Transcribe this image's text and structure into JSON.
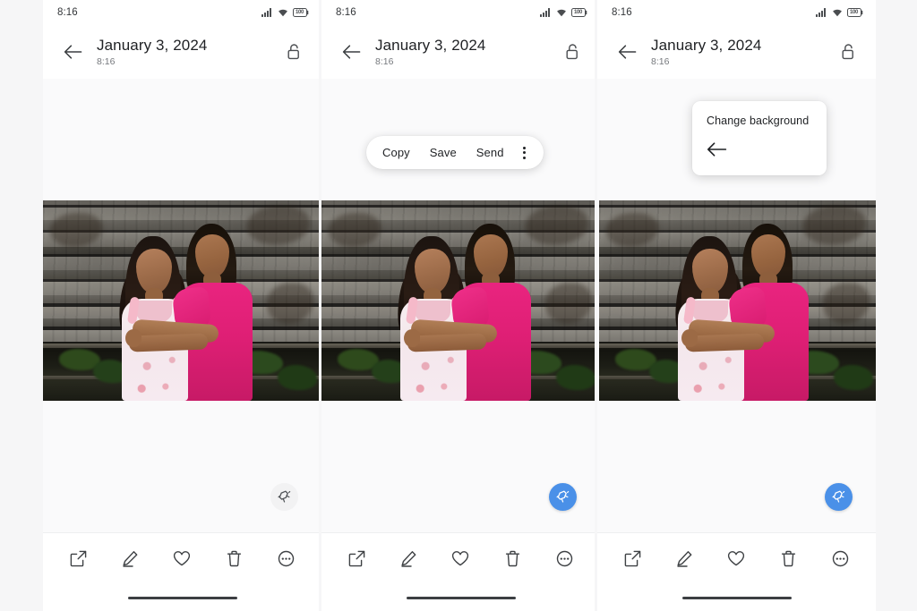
{
  "app": {
    "status_time": "8:16",
    "battery_level": "100",
    "signal_icon": "cellular-signal-icon",
    "wifi_icon": "wifi-icon",
    "battery_icon": "battery-icon"
  },
  "appbar": {
    "back_icon": "arrow-left-icon",
    "title": "January 3, 2024",
    "subtitle": "8:16",
    "lock_icon": "unlocked-padlock-icon"
  },
  "photo": {
    "alt": "Two smiling girls embracing in front of a weathered wooden plank wall",
    "caption": "two-girls-photo"
  },
  "popup_actions": {
    "copy_label": "Copy",
    "save_label": "Save",
    "send_label": "Send",
    "more_icon": "kebab-menu-icon"
  },
  "popup_background": {
    "title": "Change background",
    "back_icon": "arrow-left-icon"
  },
  "fab": {
    "icon": "magic-eraser-icon",
    "inactive_color": "#f2f2f3",
    "active_color": "#4a90e8"
  },
  "bottombar": {
    "items": [
      {
        "label": "Share",
        "icon": "share-icon"
      },
      {
        "label": "Edit",
        "icon": "pencil-icon"
      },
      {
        "label": "Favorite",
        "icon": "heart-icon"
      },
      {
        "label": "Delete",
        "icon": "trash-icon"
      },
      {
        "label": "More",
        "icon": "more-circle-icon"
      }
    ]
  },
  "panels": [
    {
      "id": "panel-1",
      "fab_state": "inactive",
      "popup": "none"
    },
    {
      "id": "panel-2",
      "fab_state": "active",
      "popup": "actions"
    },
    {
      "id": "panel-3",
      "fab_state": "active",
      "popup": "change-background"
    }
  ],
  "colors": {
    "page_background": "#f6f6f7",
    "surface": "#ffffff",
    "accent_blue": "#4a90e8",
    "text_primary": "#1f2124",
    "text_secondary": "#76797d"
  }
}
